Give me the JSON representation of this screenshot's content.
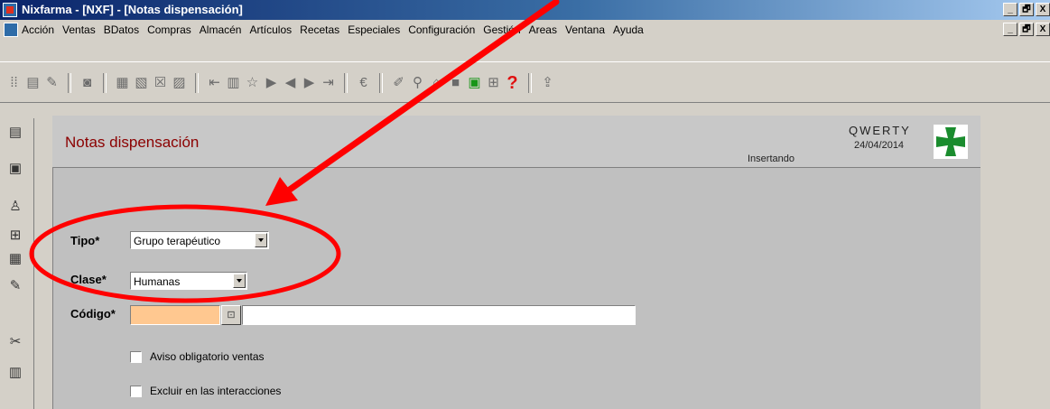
{
  "window": {
    "title": "Nixfarma - [NXF] - [Notas dispensación]",
    "minimize": "_",
    "restore": "🗗",
    "close": "X"
  },
  "menubar": {
    "items": [
      "Acción",
      "Ventas",
      "BDatos",
      "Compras",
      "Almacén",
      "Artículos",
      "Recetas",
      "Especiales",
      "Configuración",
      "Gestión",
      "Areas",
      "Ventana",
      "Ayuda"
    ]
  },
  "toolbar": {
    "help_glyph": "?"
  },
  "form": {
    "title": "Notas dispensación",
    "state": "Insertando",
    "user": "QWERTY",
    "date": "24/04/2014",
    "tipo_label": "Tipo*",
    "tipo_value": "Grupo terapéutico",
    "clase_label": "Clase*",
    "clase_value": "Humanas",
    "codigo_label": "Código*",
    "codigo_value": "",
    "descripcion_value": "",
    "aviso_label": "Aviso obligatorio ventas",
    "excluir_label": "Excluir en las interacciones"
  },
  "colors": {
    "title_red": "#8b0000",
    "codigo_bg": "#ffc890",
    "annotation_red": "#ff0000",
    "cross_green": "#1a8c2e"
  }
}
